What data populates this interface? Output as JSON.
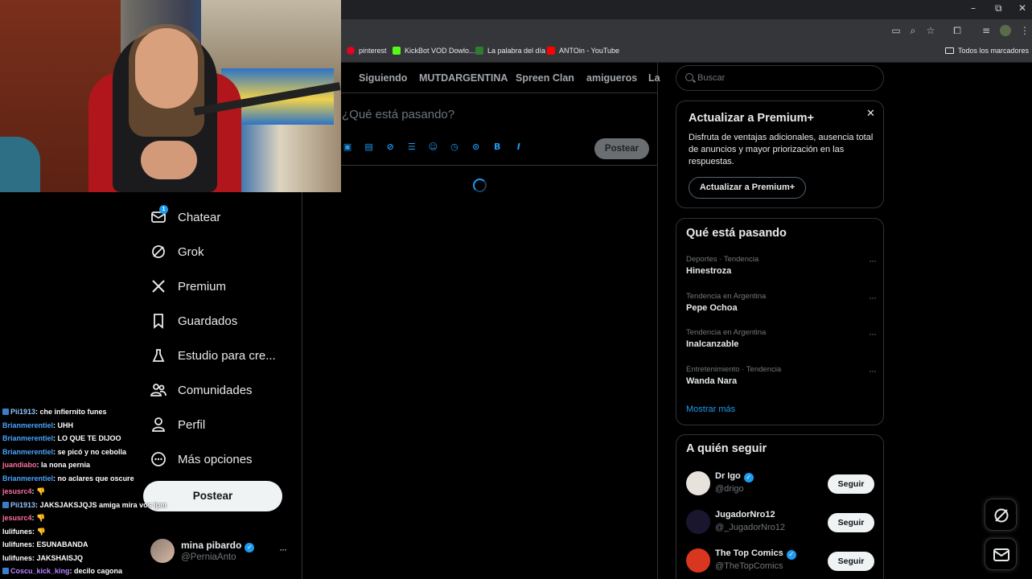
{
  "window": {
    "minimize_glyph": "–",
    "maximize_glyph": "⧉",
    "close_glyph": "✕"
  },
  "bookmarks": [
    {
      "label": "pinterest",
      "color": "#e60023"
    },
    {
      "label": "KickBot VOD Dowlo...",
      "color": "#53fc18"
    },
    {
      "label": "La palabra del día",
      "color": "#2e7d32"
    },
    {
      "label": "ANTOin - YouTube",
      "color": "#ff0000"
    }
  ],
  "bookmarks_all": "Todos los marcadores",
  "tabs": [
    "Siguiendo",
    "MUTDARGENTINA",
    "Spreen Clan",
    "amigueros",
    "La"
  ],
  "compose": {
    "placeholder": "¿Qué está pasando?",
    "post_button": "Postear",
    "icons": [
      "image-icon",
      "gif-icon",
      "grok-icon",
      "poll-icon",
      "emoji-icon",
      "schedule-icon",
      "location-icon",
      "bold-icon",
      "italic-icon"
    ]
  },
  "nav": {
    "items": [
      {
        "label": "Chatear",
        "icon": "mail-icon",
        "badge": "1"
      },
      {
        "label": "Grok",
        "icon": "grok-icon"
      },
      {
        "label": "Premium",
        "icon": "x-logo-icon"
      },
      {
        "label": "Guardados",
        "icon": "bookmark-icon"
      },
      {
        "label": "Estudio para cre...",
        "icon": "creator-studio-icon"
      },
      {
        "label": "Comunidades",
        "icon": "communities-icon"
      },
      {
        "label": "Perfil",
        "icon": "profile-icon"
      },
      {
        "label": "Más opciones",
        "icon": "more-circle-icon"
      }
    ],
    "post_button": "Postear",
    "account": {
      "name": "mina pibardo",
      "handle": "@PerniaAnto",
      "more": "···"
    }
  },
  "chat": [
    {
      "user": "Pii1913",
      "text": ": che infiernito funes",
      "color": "#8fc5ff",
      "badge": true
    },
    {
      "user": "Brianmerentiel",
      "text": ": UHH",
      "color": "#4aa3ff",
      "badge": false
    },
    {
      "user": "Brianmerentiel",
      "text": ": LO QUE TE DIJOO",
      "color": "#4aa3ff",
      "badge": false
    },
    {
      "user": "Brianmerentiel",
      "text": ": se picó y no cebolla",
      "color": "#4aa3ff",
      "badge": false
    },
    {
      "user": "juandiabo",
      "text": ": la nona pernia",
      "color": "#ff6fa0",
      "badge": false
    },
    {
      "user": "Brianmerentiel",
      "text": ": no aclares que oscure",
      "color": "#4aa3ff",
      "badge": false
    },
    {
      "user": "jesusrc4",
      "text": ": 👎",
      "color": "#ff6fa0",
      "badge": false
    },
    {
      "user": "Pii1913",
      "text": ": JAKSJAKSJQJS amiga mira vos lpm",
      "color": "#8fc5ff",
      "badge": true
    },
    {
      "user": "jesusrc4",
      "text": ": 👎",
      "color": "#ff6fa0",
      "badge": false
    },
    {
      "user": "lulifunes",
      "text": ": 👎",
      "color": "#ffffff",
      "badge": false
    },
    {
      "user": "lulifunes",
      "text": ": ESUNABANDA",
      "color": "#ffffff",
      "badge": false
    },
    {
      "user": "lulifunes",
      "text": ": JAKSHAISJQ",
      "color": "#ffffff",
      "badge": false
    },
    {
      "user": "Coscu_kick_king",
      "text": ": decilo cagona",
      "color": "#b983ff",
      "badge": true
    }
  ],
  "search": {
    "placeholder": "Buscar"
  },
  "premium": {
    "title": "Actualizar a Premium+",
    "close": "✕",
    "description": "Disfruta de ventajas adicionales, ausencia total de anuncios y mayor priorización en las respuestas.",
    "button": "Actualizar a Premium+"
  },
  "trends": {
    "title": "Qué está pasando",
    "items": [
      {
        "meta": "Deportes · Tendencia",
        "name": "Hinestroza"
      },
      {
        "meta": "Tendencia en Argentina",
        "name": "Pepe Ochoa"
      },
      {
        "meta": "Tendencia en Argentina",
        "name": "Inalcanzable"
      },
      {
        "meta": "Entretenimiento · Tendencia",
        "name": "Wanda Nara"
      }
    ],
    "more_glyph": "···",
    "show_more": "Mostrar más"
  },
  "follow": {
    "title": "A quién seguir",
    "items": [
      {
        "name": "Dr Igo",
        "handle": "@drigo",
        "verified": true,
        "button": "Seguir",
        "avatar_color": "#e8e2dc"
      },
      {
        "name": "JugadorNro12",
        "handle": "@_JugadorNro12",
        "verified": false,
        "button": "Seguir",
        "avatar_color": "#1a1630"
      },
      {
        "name": "The Top Comics",
        "handle": "@TheTopComics",
        "verified": true,
        "button": "Seguir",
        "avatar_color": "#d9361f"
      }
    ]
  },
  "colors": {
    "accent": "#1d9bf0",
    "background": "#000000",
    "border": "#2f3336"
  }
}
